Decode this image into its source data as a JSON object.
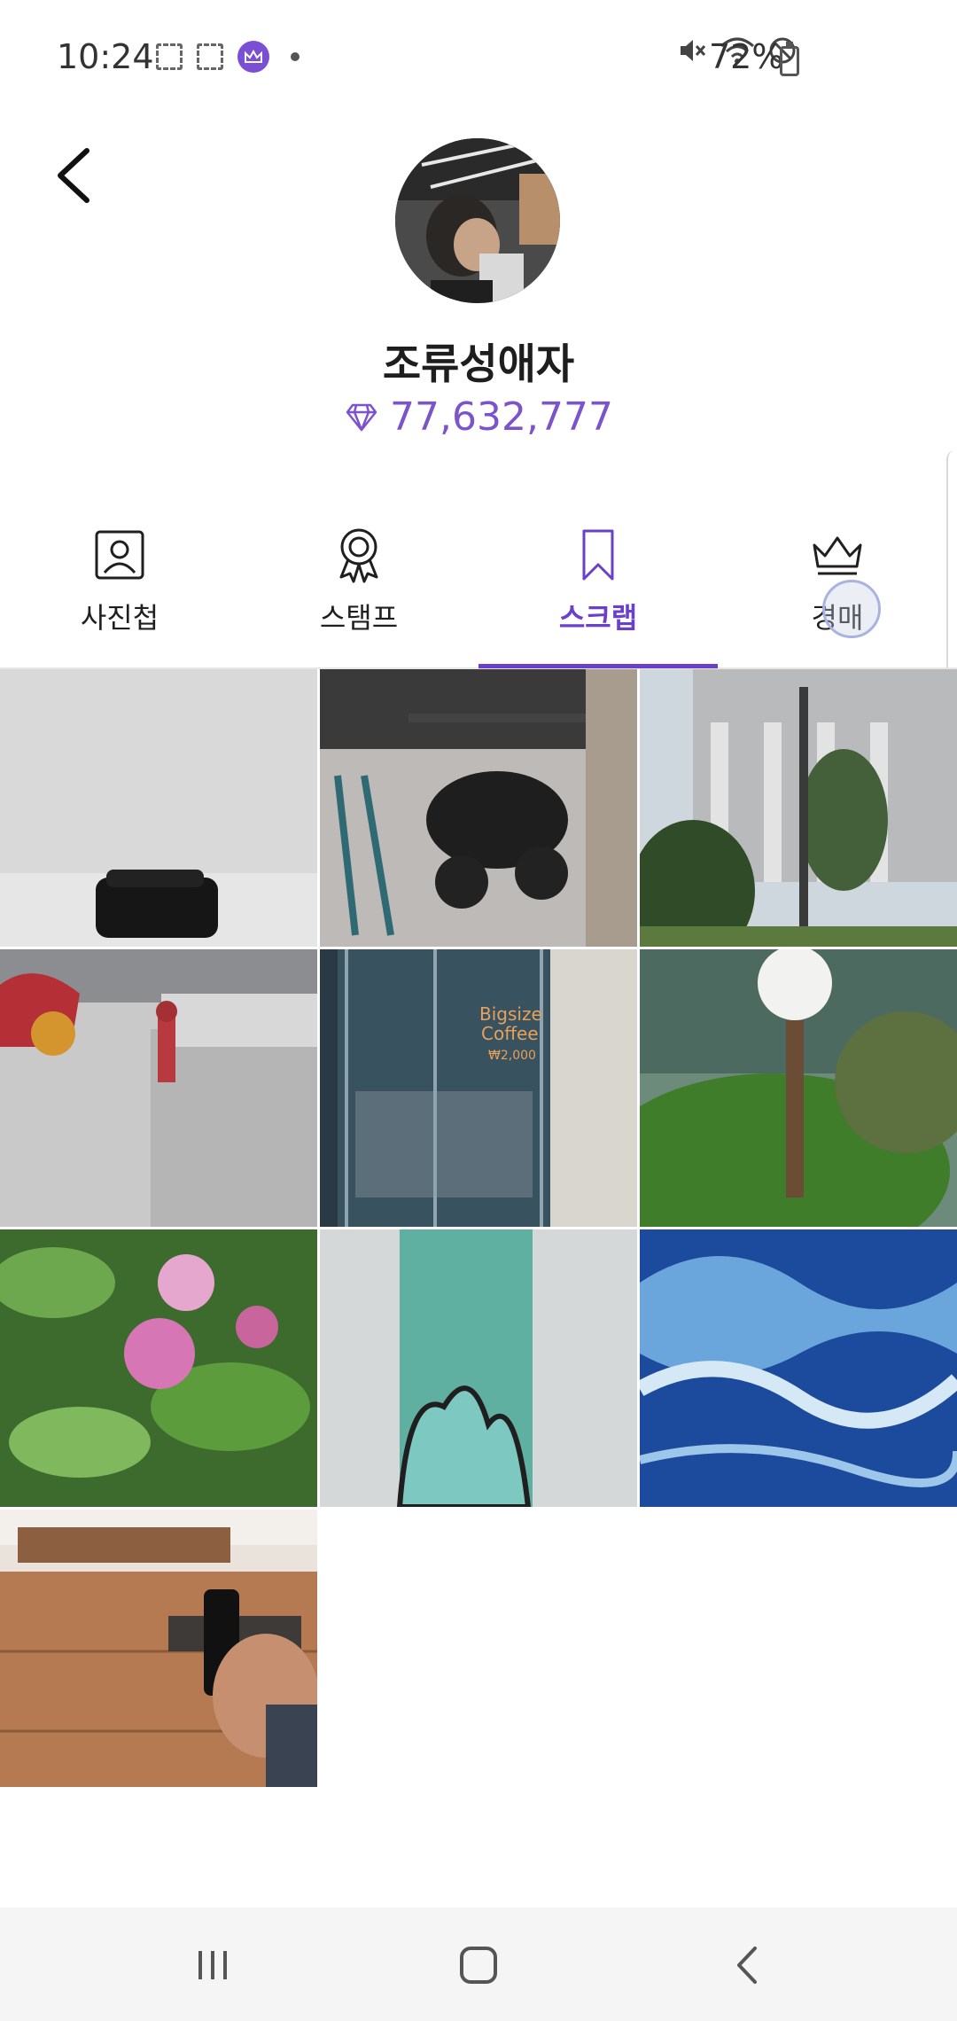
{
  "status_bar": {
    "time": "10:24",
    "battery": "72%"
  },
  "profile": {
    "username": "조류성애자",
    "points": "77,632,777"
  },
  "tabs": [
    {
      "label": "사진첩",
      "icon": "person-portrait-icon",
      "active": false
    },
    {
      "label": "스탬프",
      "icon": "award-badge-icon",
      "active": false
    },
    {
      "label": "스크랩",
      "icon": "bookmark-icon",
      "active": true
    },
    {
      "label": "경매",
      "icon": "crown-icon",
      "active": false
    }
  ],
  "grid": [
    {
      "subject": "black-backpack-photo"
    },
    {
      "subject": "scooters-parked-photo"
    },
    {
      "subject": "stone-building-photo"
    },
    {
      "subject": "fire-hydrant-photo"
    },
    {
      "subject": "glass-storefront-photo"
    },
    {
      "subject": "garden-lamp-photo"
    },
    {
      "subject": "azalea-flowers-photo"
    },
    {
      "subject": "teal-stripe-mural-photo"
    },
    {
      "subject": "ocean-waves-photo"
    },
    {
      "subject": "wooden-table-phone-photo"
    }
  ],
  "storefront_sign": {
    "line1": "Bigsize",
    "line2": "Coffee",
    "line3": "₩2,000"
  },
  "colors": {
    "accent": "#6a3fc9",
    "points": "#7b53cc"
  }
}
